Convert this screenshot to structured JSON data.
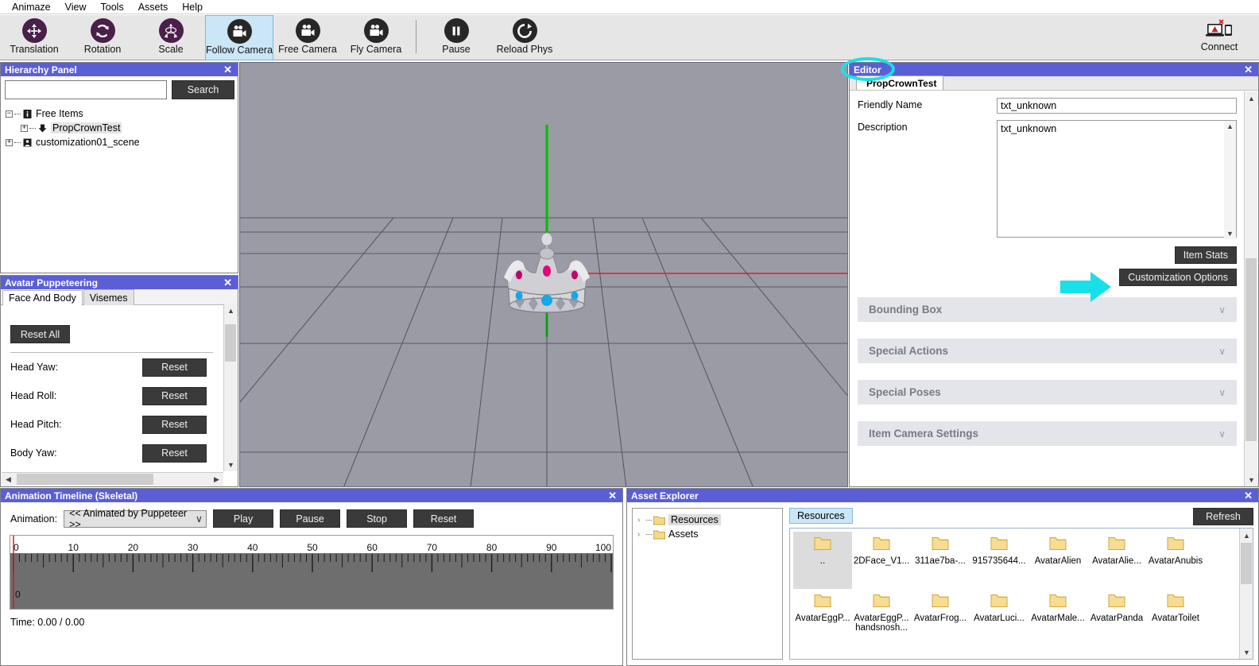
{
  "menu": {
    "items": [
      {
        "label": "Animaze"
      },
      {
        "label": "View"
      },
      {
        "label": "Tools"
      },
      {
        "label": "Assets"
      },
      {
        "label": "Help"
      }
    ]
  },
  "toolbar": {
    "tools": [
      {
        "label": "Translation",
        "icon": "translation-icon",
        "active": false
      },
      {
        "label": "Rotation",
        "icon": "rotation-icon",
        "active": false
      },
      {
        "label": "Scale",
        "icon": "scale-icon",
        "active": false
      },
      {
        "label": "Follow Camera",
        "icon": "camera-icon",
        "active": true
      },
      {
        "label": "Free Camera",
        "icon": "camera-icon",
        "active": false
      },
      {
        "label": "Fly Camera",
        "icon": "camera-icon",
        "active": false
      },
      {
        "label": "Pause",
        "icon": "pause-icon",
        "active": false
      },
      {
        "label": "Reload Phys",
        "icon": "reload-icon",
        "active": false
      }
    ],
    "connect": {
      "label": "Connect",
      "icon": "connect-icon"
    },
    "accent_purple": "#4a1f49",
    "accent_dark": "#272727",
    "active_tab_bg": "#cbe6f7"
  },
  "hierarchy": {
    "title": "Hierarchy Panel",
    "close": "✕",
    "search": {
      "value": "",
      "placeholder": "",
      "button_label": "Search"
    },
    "tree": [
      {
        "label": "Free Items",
        "expander": "−",
        "icon": "info-icon",
        "level": 0,
        "selected": false
      },
      {
        "label": "PropCrownTest",
        "expander": "+",
        "icon": "prop-icon",
        "level": 1,
        "selected": true
      },
      {
        "label": "customization01_scene",
        "expander": "+",
        "icon": "scene-icon",
        "level": 0,
        "selected": false
      }
    ]
  },
  "puppeteering": {
    "title": "Avatar Puppeteering",
    "close": "✕",
    "tabs": [
      {
        "label": "Face And Body",
        "active": true
      },
      {
        "label": "Visemes",
        "active": false
      }
    ],
    "reset_all_label": "Reset All",
    "rows": [
      {
        "label": "Head Yaw:",
        "button": "Reset"
      },
      {
        "label": "Head Roll:",
        "button": "Reset"
      },
      {
        "label": "Head Pitch:",
        "button": "Reset"
      },
      {
        "label": "Body Yaw:",
        "button": "Reset"
      }
    ]
  },
  "viewport": {
    "background": "#9b9ba6",
    "grid_color": "#4e4e58",
    "axis_y_color": "#00c000",
    "axis_x_color": "#e02020",
    "model": "crown",
    "gem_magenta": "#e6007e",
    "gem_cyan": "#14a8e8"
  },
  "editor": {
    "title": "Editor",
    "close": "✕",
    "tab_label": "PropCrownTest",
    "friendly_name": {
      "label": "Friendly Name",
      "value": "txt_unknown"
    },
    "description": {
      "label": "Description",
      "value": "txt_unknown"
    },
    "item_stats_label": "Item Stats",
    "customization_options_label": "Customization Options",
    "sections": [
      {
        "label": "Bounding Box",
        "chevron": "∨"
      },
      {
        "label": "Special Actions",
        "chevron": "∨"
      },
      {
        "label": "Special Poses",
        "chevron": "∨"
      },
      {
        "label": "Item Camera Settings",
        "chevron": "∨"
      }
    ]
  },
  "annotations": {
    "highlight_color": "#19e0e8",
    "circle_target": "Editor",
    "arrow_target": "Customization Options"
  },
  "timeline": {
    "title": "Animation Timeline (Skeletal)",
    "close": "✕",
    "animation_label": "Animation:",
    "animation_value": "<< Animated by Puppeteer >>",
    "chevron": "∨",
    "buttons": [
      {
        "label": "Play"
      },
      {
        "label": "Pause"
      },
      {
        "label": "Stop"
      },
      {
        "label": "Reset"
      }
    ],
    "ruler_ticks": [
      "0",
      "10",
      "20",
      "30",
      "40",
      "50",
      "60",
      "70",
      "80",
      "90",
      "100"
    ],
    "playhead_label": "0",
    "time_label": "Time: 0.00 / 0.00"
  },
  "assets": {
    "title": "Asset Explorer",
    "close": "✕",
    "tree": [
      {
        "label": "Resources",
        "chevron": "›",
        "selected": true
      },
      {
        "label": "Assets",
        "chevron": "›",
        "selected": false
      }
    ],
    "tab_label": "Resources",
    "refresh_label": "Refresh",
    "items": [
      {
        "name": "..",
        "selected": true
      },
      {
        "name": "2DFace_V1...",
        "selected": false
      },
      {
        "name": "311ae7ba-...",
        "selected": false
      },
      {
        "name": "915735644...",
        "selected": false
      },
      {
        "name": "AvatarAlien",
        "selected": false
      },
      {
        "name": "AvatarAlie...",
        "selected": false
      },
      {
        "name": "AvatarAnubis",
        "selected": false
      },
      {
        "name": "AvatarEggP...",
        "selected": false
      },
      {
        "name": "AvatarEggP... handsnosh...",
        "selected": false
      },
      {
        "name": "AvatarFrog...",
        "selected": false
      },
      {
        "name": "AvatarLuci...",
        "selected": false
      },
      {
        "name": "AvatarMale...",
        "selected": false
      },
      {
        "name": "AvatarPanda",
        "selected": false
      },
      {
        "name": "AvatarToilet",
        "selected": false
      }
    ]
  }
}
